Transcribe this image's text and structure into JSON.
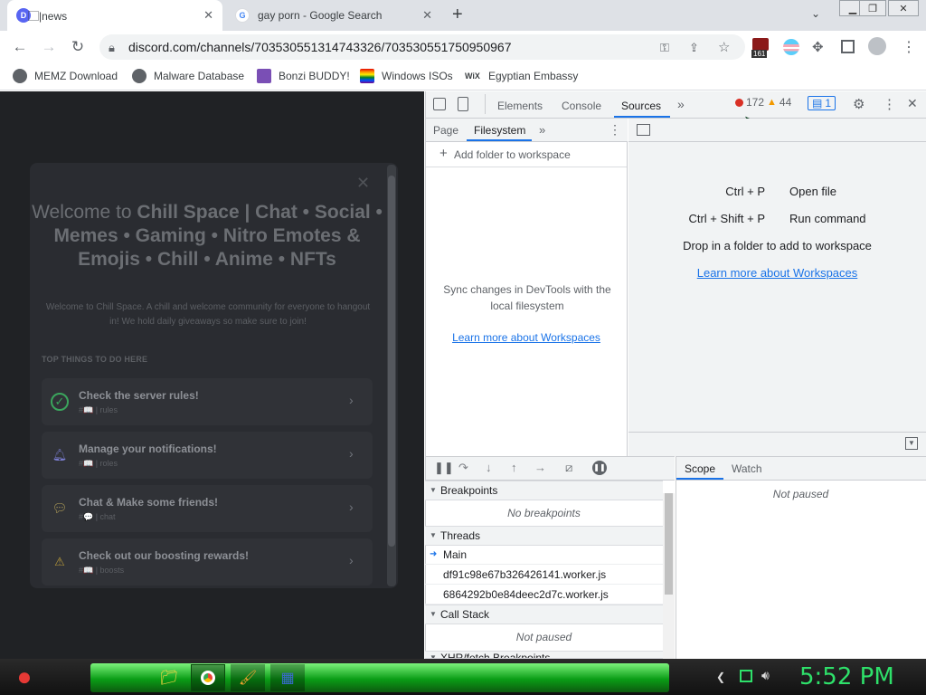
{
  "browser": {
    "tabs": [
      {
        "title": "⃞|news",
        "close": "✕"
      },
      {
        "title": "gay porn - Google Search",
        "close": "✕"
      }
    ],
    "new_tab": "+",
    "url": "discord.com/channels/703530551314743326/703530551750950967",
    "bookmarks": [
      "MEMZ Download",
      "Malware Database",
      "Bonzi BUDDY!",
      "Windows ISOs",
      "Egyptian Embassy"
    ],
    "ext_badge": "161"
  },
  "discord": {
    "title_welcome": "Welcome to ",
    "title_name": "Chill Space | Chat • Social • Memes • Gaming • Nitro Emotes & Emojis • Chill • Anime • NFTs",
    "description": "Welcome to Chill Space. A chill and welcome community for everyone to hangout in! We hold daily giveaways so make sure to join!",
    "section_heading": "TOP THINGS TO DO HERE",
    "tasks": [
      {
        "title": "Check the server rules!",
        "channel": "#📖 | rules"
      },
      {
        "title": "Manage your notifications!",
        "channel": "#📖 | roles"
      },
      {
        "title": "Chat & Make some friends!",
        "channel": "#💬 | chat"
      },
      {
        "title": "Check out our boosting rewards!",
        "channel": "#📖 | boosts"
      }
    ]
  },
  "devtools": {
    "tabs": [
      "Elements",
      "Console",
      "Sources"
    ],
    "active_tab": "Sources",
    "errors": "172",
    "warnings": "44",
    "messages": "1",
    "nav_tabs": [
      "Page",
      "Filesystem"
    ],
    "add_folder": "Add folder to workspace",
    "sync_text": "Sync changes in DevTools with the local filesystem",
    "learn_more": "Learn more about Workspaces",
    "shortcuts": [
      {
        "keys": "Ctrl + P",
        "action": "Open file"
      },
      {
        "keys": "Ctrl + Shift + P",
        "action": "Run command"
      }
    ],
    "drop_text": "Drop in a folder to add to workspace",
    "scope_tabs": [
      "Scope",
      "Watch"
    ],
    "not_paused": "Not paused",
    "breakpoints_label": "Breakpoints",
    "no_breakpoints": "No breakpoints",
    "threads_label": "Threads",
    "threads": [
      "Main",
      "df91c98e67b326426141.worker.js",
      "6864292b0e84deec2d7c.worker.js"
    ],
    "callstack_label": "Call Stack",
    "xhr_label": "XHR/fetch Breakpoints"
  },
  "taskbar": {
    "clock": "5:52 PM"
  },
  "colors": {
    "accent_blue": "#1a73e8",
    "discord_bg": "#202225",
    "taskbar_green": "#0a9d16",
    "clock_green": "#2ee06a"
  }
}
